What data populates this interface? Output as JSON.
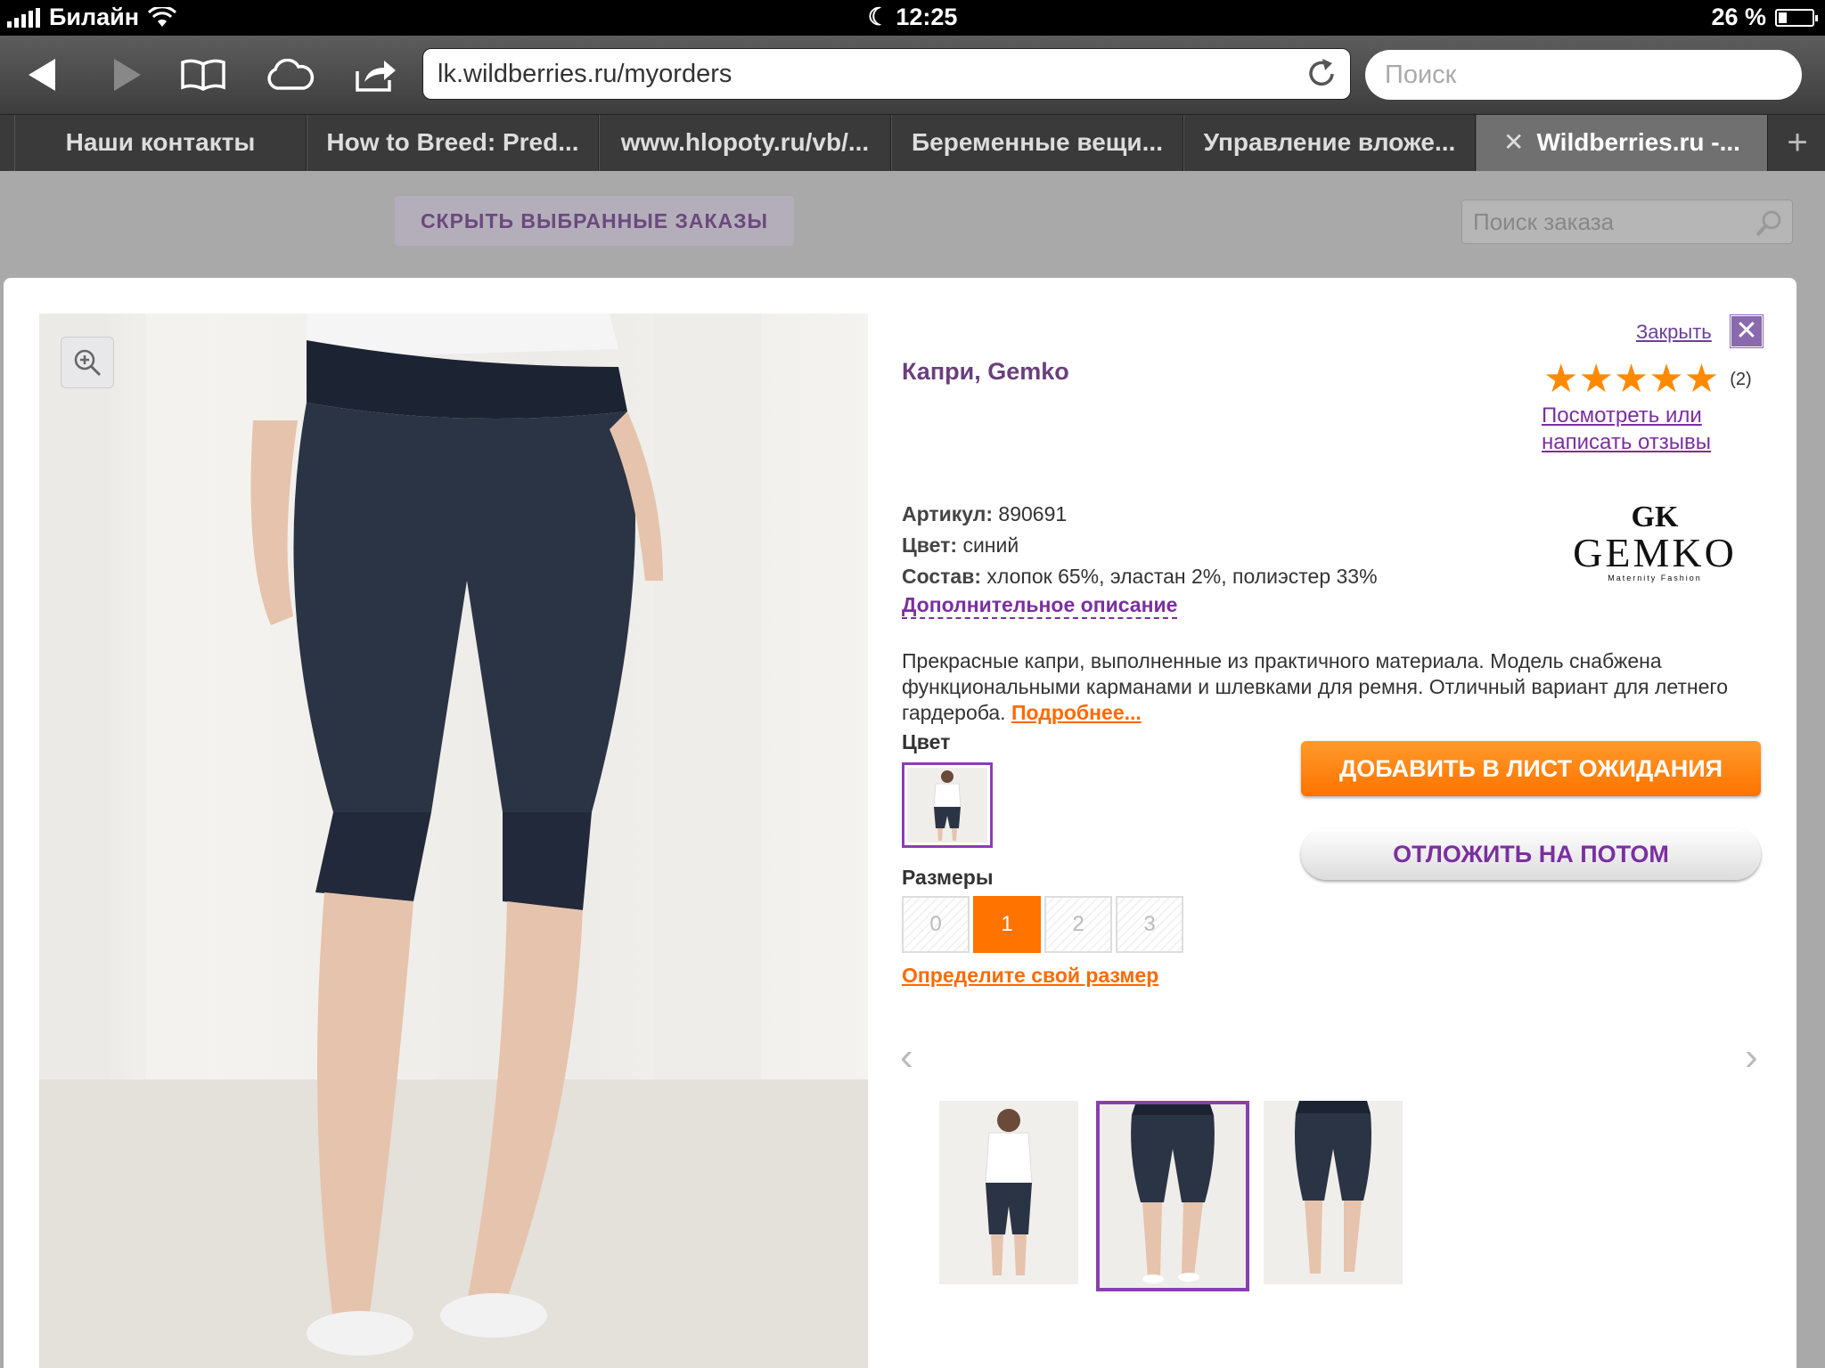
{
  "status": {
    "carrier": "Билайн",
    "time": "12:25",
    "battery": "26 %",
    "battery_level": 0.26
  },
  "browser": {
    "url": "lk.wildberries.ru/myorders",
    "search_placeholder": "Поиск",
    "tabs": [
      {
        "label": "Наши контакты"
      },
      {
        "label": "How to Breed: Pred..."
      },
      {
        "label": "www.hlopoty.ru/vb/..."
      },
      {
        "label": "Беременные вещи..."
      },
      {
        "label": "Управление вложе..."
      },
      {
        "label": "Wildberries.ru -..."
      }
    ],
    "close_tab": "✕",
    "new_tab": "+"
  },
  "page": {
    "hide_button": "СКРЫТЬ ВЫБРАННЫЕ ЗАКАЗЫ",
    "order_search_placeholder": "Поиск заказа"
  },
  "product": {
    "close_label": "Закрыть",
    "close_x": "✕",
    "title": "Капри, Gemko",
    "stars": "★★★★★",
    "rating": 5,
    "review_count": "(2)",
    "reviews_link": "Посмотреть или написать отзывы",
    "article_label": "Артикул:",
    "article_value": "890691",
    "color_label": "Цвет:",
    "color_value": "синий",
    "composition_label": "Состав:",
    "composition_value": "хлопок 65%, эластан 2%, полиэстер 33%",
    "more_desc": "Дополнительное описание",
    "brand_logo": {
      "word": "GEMKO",
      "sub": "Maternity Fashion",
      "mark": "GK"
    },
    "description": "Прекрасные капри, выполненные из практичного материала. Модель снабжена функциональными карманами и шлевками для ремня. Отличный вариант для летнего гардероба.",
    "read_more": "Подробнее...",
    "color_section": "Цвет",
    "add_waitlist": "ДОБАВИТЬ В ЛИСТ ОЖИДАНИЯ",
    "postpone": "ОТЛОЖИТЬ НА ПОТОМ",
    "sizes_section": "Размеры",
    "sizes": [
      "0",
      "1",
      "2",
      "3"
    ],
    "selected_size": "1",
    "find_size": "Определите свой размер",
    "prev_arrow": "‹",
    "next_arrow": "›"
  },
  "colors": {
    "accent_purple": "#7b2fa0",
    "accent_orange": "#ff7300",
    "denim": "#2a3445"
  }
}
